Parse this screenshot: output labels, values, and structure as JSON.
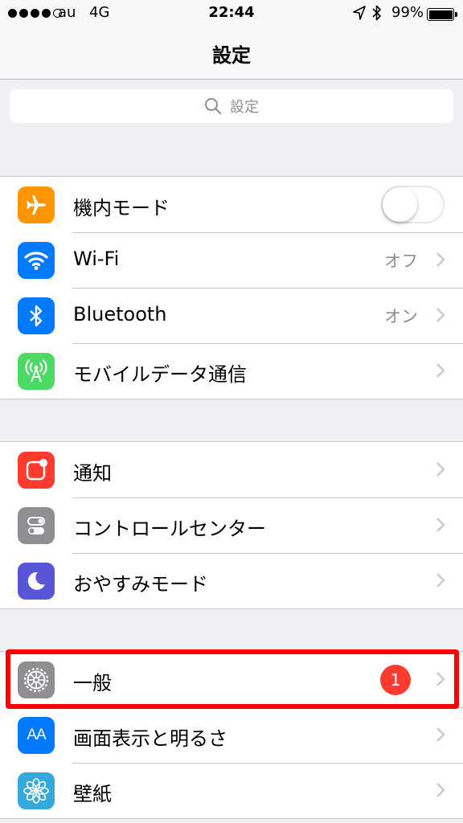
{
  "status_bar": {
    "carrier": "au",
    "network": "4G",
    "time": "22:44",
    "battery": "99%"
  },
  "nav": {
    "title": "設定"
  },
  "search": {
    "placeholder": "設定"
  },
  "sections": [
    [
      {
        "label": "機内モード",
        "icon": "airplane-icon",
        "color": "#ff9500",
        "toggle_on": false
      },
      {
        "label": "Wi-Fi",
        "icon": "wifi-icon",
        "color": "#007aff",
        "detail": "オフ"
      },
      {
        "label": "Bluetooth",
        "icon": "bluetooth-icon",
        "color": "#007aff",
        "detail": "オン"
      },
      {
        "label": "モバイルデータ通信",
        "icon": "cellular-antenna-icon",
        "color": "#4cd964"
      }
    ],
    [
      {
        "label": "通知",
        "icon": "notifications-icon",
        "color": "#ff3b30"
      },
      {
        "label": "コントロールセンター",
        "icon": "control-center-icon",
        "color": "#8e8e93"
      },
      {
        "label": "おやすみモード",
        "icon": "moon-icon",
        "color": "#5856d6"
      }
    ],
    [
      {
        "label": "一般",
        "icon": "gear-icon",
        "color": "#8e8e93",
        "badge": "1"
      },
      {
        "label": "画面表示と明るさ",
        "icon": "text-size-icon",
        "icon_text": "AA",
        "color": "#007aff"
      },
      {
        "label": "壁紙",
        "icon": "wallpaper-flower-icon",
        "color": "#34aadc"
      }
    ]
  ]
}
